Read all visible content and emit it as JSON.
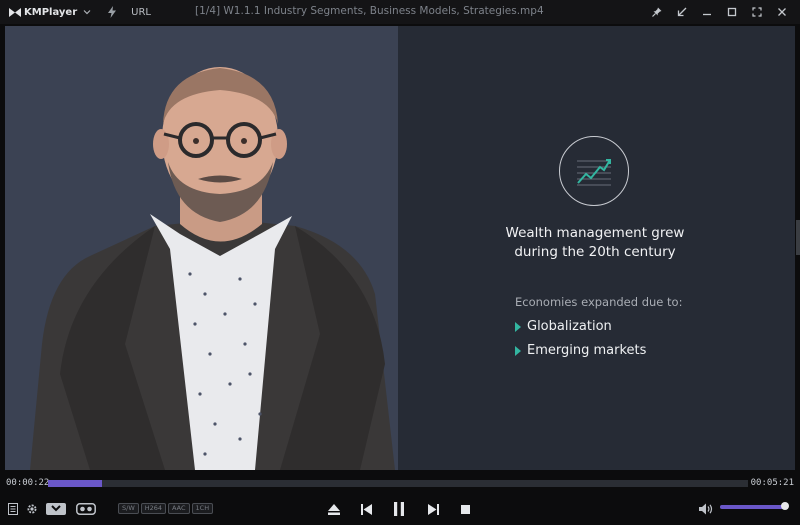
{
  "app": {
    "name": "KMPlayer",
    "url_label": "URL",
    "window_title": "[1/4] W1.1.1 Industry Segments, Business Models, Strategies.mp4"
  },
  "slide": {
    "headline_line1": "Wealth management grew",
    "headline_line2": "during the 20th century",
    "subheading": "Economies expanded due to:",
    "bullets": [
      "Globalization",
      "Emerging markets"
    ],
    "bullet_color": "#33b6a1",
    "chart_icon": "growth-chart-icon"
  },
  "playback": {
    "current_time": "00:00:22",
    "total_time": "00:05:21",
    "progress": 0.077,
    "volume": 1.0,
    "state": "playing"
  },
  "codecs": [
    "S/W",
    "H264",
    "AAC",
    "1CH"
  ],
  "colors": {
    "accent": "#6a57c8",
    "titlebar_bg": "#141416",
    "controls_bg": "#0c0c0d"
  },
  "icons": {
    "titlebar": [
      "kmplayer-logo-icon",
      "chevron-down-icon",
      "lightning-icon",
      "pin-icon",
      "compact-mode-icon",
      "minimize-icon",
      "maximize-icon",
      "fullscreen-icon",
      "close-icon"
    ],
    "controls": [
      "playlist-icon",
      "settings-icon",
      "3d-glasses-icon",
      "vr-icon",
      "eject-icon",
      "previous-icon",
      "pause-icon",
      "next-icon",
      "stop-icon",
      "volume-icon"
    ]
  }
}
